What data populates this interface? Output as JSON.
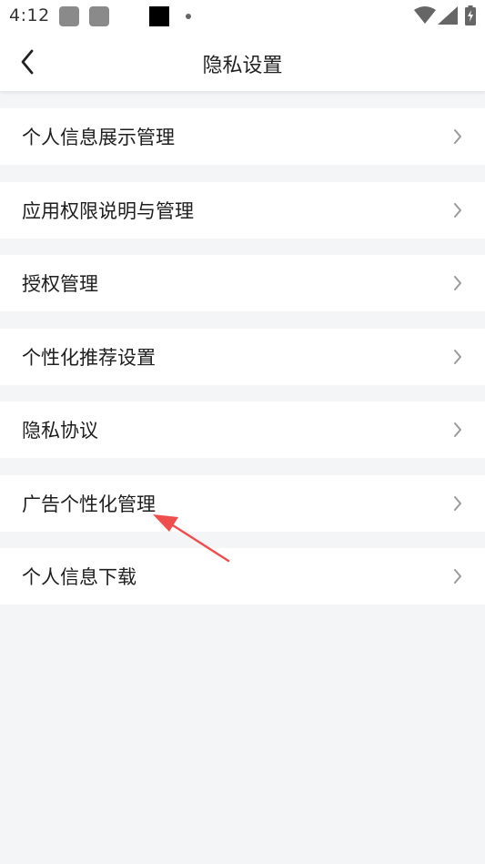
{
  "status_bar": {
    "time": "4:12"
  },
  "header": {
    "title": "隐私设置",
    "back_icon": "chevron-left-icon"
  },
  "menu": {
    "items": [
      {
        "label": "个人信息展示管理"
      },
      {
        "label": "应用权限说明与管理"
      },
      {
        "label": "授权管理"
      },
      {
        "label": "个性化推荐设置"
      },
      {
        "label": "隐私协议"
      },
      {
        "label": "广告个性化管理"
      },
      {
        "label": "个人信息下载"
      }
    ],
    "chevron_icon": "chevron-right-icon"
  },
  "annotation": {
    "color": "#f04d4d",
    "target": "广告个性化管理"
  }
}
